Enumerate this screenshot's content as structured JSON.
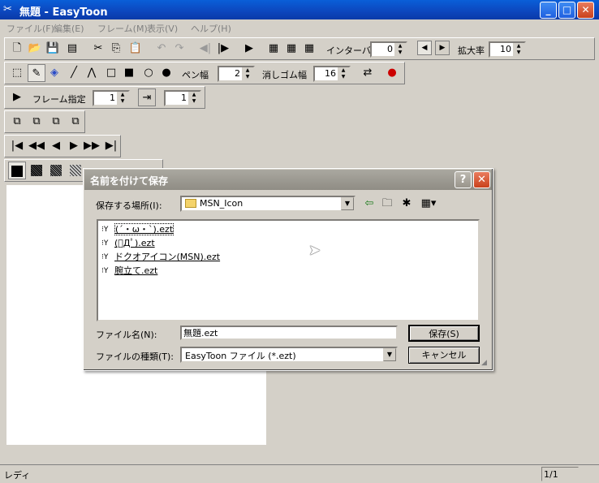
{
  "window": {
    "title": "無題 - EasyToon",
    "icon": "easytoon-scissors-icon",
    "minimize": "_",
    "maximize": "□",
    "close": "✕"
  },
  "menu": [
    "ファイル(F)",
    "編集(E)",
    "フレーム(M)",
    "表示(V)",
    "ヘルプ(H)"
  ],
  "toolbar1": {
    "interval_label": "インターバル",
    "interval_value": "0",
    "zoom_label": "拡大率",
    "zoom_value": "10"
  },
  "toolbar2": {
    "pen_width_label": "ペン幅",
    "pen_width_value": "2",
    "eraser_width_label": "消しゴム幅",
    "eraser_width_value": "16"
  },
  "toolbar3": {
    "frame_label": "フレーム指定",
    "frame_value": "1",
    "frame_value2": "1"
  },
  "status": {
    "text": "レディ",
    "page": "1/1"
  },
  "dialog": {
    "title": "名前を付けて保存",
    "help": "?",
    "close": "✕",
    "location_label": "保存する場所(I):",
    "location_value": "MSN_Icon",
    "files": [
      "(´・ω・`).ezt",
      "(ﾟДﾟ).ezt",
      "ドクオアイコン(MSN).ezt",
      "腕立て.ezt"
    ],
    "filename_label": "ファイル名(N):",
    "filename_value": "無題.ezt",
    "filetype_label": "ファイルの種類(T):",
    "filetype_value": "EasyToon ファイル (*.ezt)",
    "save_button": "保存(S)",
    "cancel_button": "キャンセル"
  }
}
